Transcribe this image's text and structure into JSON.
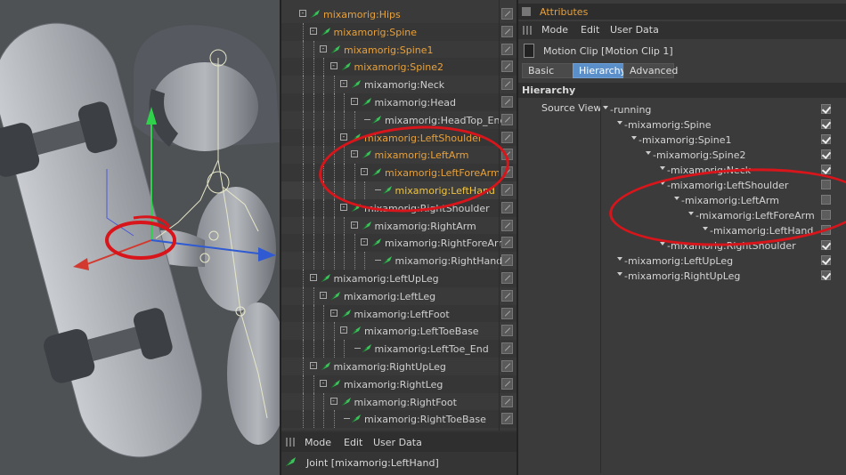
{
  "object_manager": {
    "items": [
      {
        "label": "mixamorig:Hips",
        "depth": 0,
        "color": "orange"
      },
      {
        "label": "mixamorig:Spine",
        "depth": 1,
        "color": "orange"
      },
      {
        "label": "mixamorig:Spine1",
        "depth": 2,
        "color": "orange"
      },
      {
        "label": "mixamorig:Spine2",
        "depth": 3,
        "color": "orange"
      },
      {
        "label": "mixamorig:Neck",
        "depth": 4,
        "color": "gray"
      },
      {
        "label": "mixamorig:Head",
        "depth": 5,
        "color": "gray"
      },
      {
        "label": "mixamorig:HeadTop_End",
        "depth": 6,
        "color": "gray"
      },
      {
        "label": "mixamorig:LeftShoulder",
        "depth": 4,
        "color": "orange"
      },
      {
        "label": "mixamorig:LeftArm",
        "depth": 5,
        "color": "orange"
      },
      {
        "label": "mixamorig:LeftForeArm",
        "depth": 6,
        "color": "orange"
      },
      {
        "label": "mixamorig:LeftHand",
        "depth": 7,
        "color": "yellow"
      },
      {
        "label": "mixamorig:RightShoulder",
        "depth": 4,
        "color": "gray"
      },
      {
        "label": "mixamorig:RightArm",
        "depth": 5,
        "color": "gray"
      },
      {
        "label": "mixamorig:RightForeArm",
        "depth": 6,
        "color": "gray"
      },
      {
        "label": "mixamorig:RightHand",
        "depth": 7,
        "color": "gray"
      },
      {
        "label": "mixamorig:LeftUpLeg",
        "depth": 1,
        "color": "gray"
      },
      {
        "label": "mixamorig:LeftLeg",
        "depth": 2,
        "color": "gray"
      },
      {
        "label": "mixamorig:LeftFoot",
        "depth": 3,
        "color": "gray"
      },
      {
        "label": "mixamorig:LeftToeBase",
        "depth": 4,
        "color": "gray"
      },
      {
        "label": "mixamorig:LeftToe_End",
        "depth": 5,
        "color": "gray"
      },
      {
        "label": "mixamorig:RightUpLeg",
        "depth": 1,
        "color": "gray"
      },
      {
        "label": "mixamorig:RightLeg",
        "depth": 2,
        "color": "gray"
      },
      {
        "label": "mixamorig:RightFoot",
        "depth": 3,
        "color": "gray"
      },
      {
        "label": "mixamorig:RightToeBase",
        "depth": 4,
        "color": "gray"
      }
    ]
  },
  "lower_attr": {
    "menu": [
      "Mode",
      "Edit",
      "User Data"
    ],
    "joint_label": "Joint [mixamorig:LeftHand]"
  },
  "attributes": {
    "title": "Attributes",
    "menu": [
      "Mode",
      "Edit",
      "User Data"
    ],
    "object_label": "Motion Clip [Motion Clip 1]",
    "tabs": [
      "Basic",
      "Hierarchy",
      "Advanced"
    ],
    "active_tab": "Hierarchy",
    "section": "Hierarchy",
    "source_view_label": "Source View",
    "hierarchy": [
      {
        "label": "running",
        "depth": 0,
        "checked": true
      },
      {
        "label": "mixamorig:Spine",
        "depth": 1,
        "checked": true
      },
      {
        "label": "mixamorig:Spine1",
        "depth": 2,
        "checked": true
      },
      {
        "label": "mixamorig:Spine2",
        "depth": 3,
        "checked": true
      },
      {
        "label": "mixamorig:Neck",
        "depth": 4,
        "checked": true
      },
      {
        "label": "mixamorig:LeftShoulder",
        "depth": 4,
        "checked": false
      },
      {
        "label": "mixamorig:LeftArm",
        "depth": 5,
        "checked": false
      },
      {
        "label": "mixamorig:LeftForeArm",
        "depth": 6,
        "checked": false
      },
      {
        "label": "mixamorig:LeftHand",
        "depth": 7,
        "checked": false
      },
      {
        "label": "mixamorig:RightShoulder",
        "depth": 4,
        "checked": true
      },
      {
        "label": "mixamorig:LeftUpLeg",
        "depth": 1,
        "checked": true
      },
      {
        "label": "mixamorig:RightUpLeg",
        "depth": 1,
        "checked": true
      }
    ]
  },
  "colors": {
    "accent_orange": "#e8a13a",
    "selected_yellow": "#f2c53d",
    "active_tab_blue": "#5b8fc9",
    "annotation_red": "#d8151b"
  }
}
